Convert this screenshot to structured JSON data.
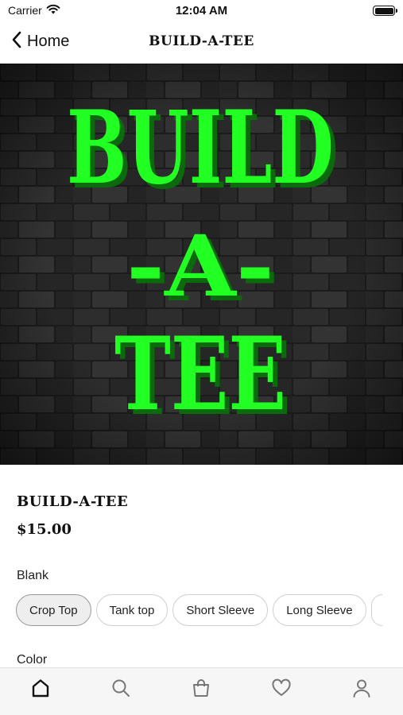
{
  "status_bar": {
    "carrier": "Carrier",
    "time": "12:04 AM",
    "icons": [
      "wifi-icon",
      "battery-icon"
    ]
  },
  "nav": {
    "back_label": "Home",
    "title": "BUILD-A-TEE",
    "icons": [
      "chevron-left-icon"
    ]
  },
  "hero": {
    "lines": [
      "BUILD",
      "-A-",
      "TEE"
    ],
    "text_color": "#22ff22",
    "shadow_color": "#0b6a0b",
    "background": "brick wall"
  },
  "product": {
    "name": "BUILD-A-TEE",
    "price": "$15.00"
  },
  "options": {
    "blank_label": "Blank",
    "blank_options": [
      "Crop Top",
      "Tank top",
      "Short Sleeve",
      "Long Sleeve"
    ],
    "selected_blank": "Crop Top",
    "color_label": "Color"
  },
  "tab_bar": {
    "tabs": [
      "home-icon",
      "search-icon",
      "bag-icon",
      "heart-icon",
      "profile-icon"
    ],
    "active_tab": "home-icon"
  }
}
